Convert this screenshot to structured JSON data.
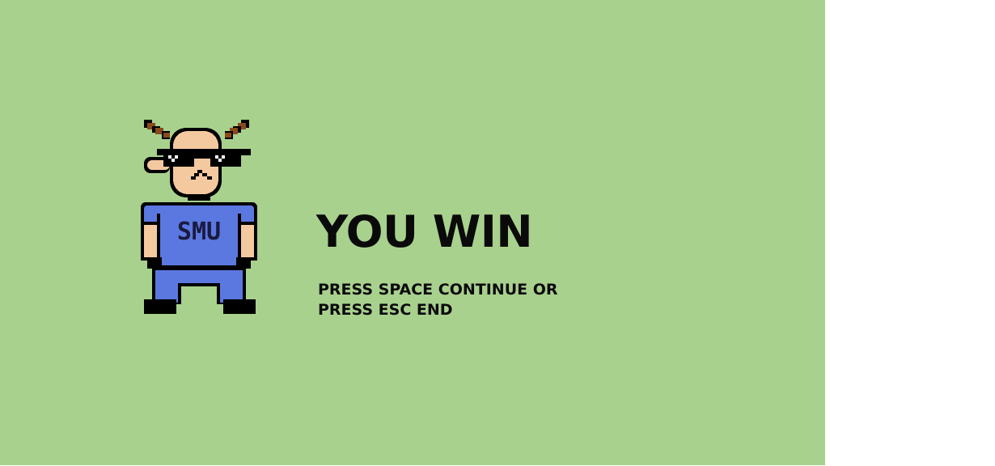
{
  "screen": {
    "title": "YOU WIN",
    "instruction_lines": [
      "PRESS SPACE CONTINUE OR",
      "PRESS ESC END"
    ]
  },
  "character": {
    "shirt_text": "SMU",
    "icon": "pixel-goat-with-sunglasses-character"
  },
  "colors": {
    "background": "#a9d18e",
    "skin": "#f5c9a0",
    "shirt": "#5b78e0",
    "horns": "#8a4a1e",
    "outline": "#000000"
  }
}
